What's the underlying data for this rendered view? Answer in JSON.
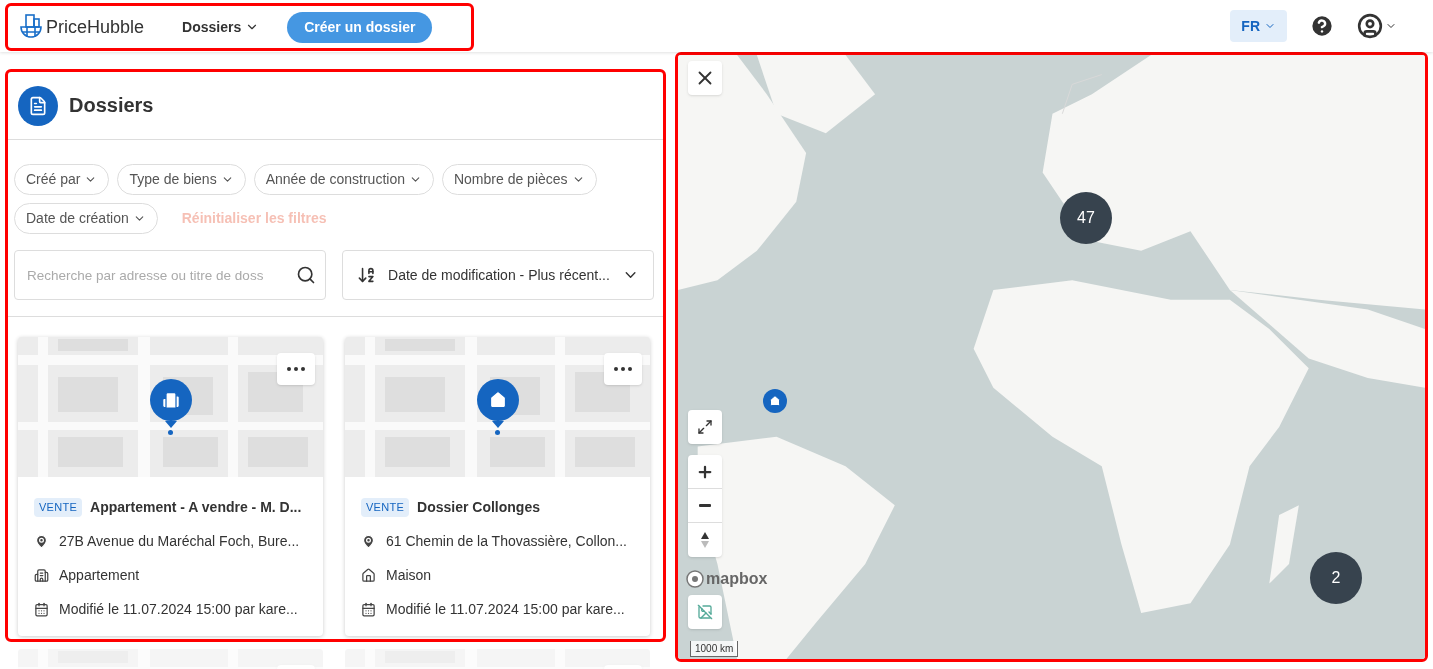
{
  "header": {
    "logo": "PriceHubble",
    "nav": [
      {
        "label": "Dossiers"
      }
    ],
    "create_button": "Créer un dossier",
    "language": "FR"
  },
  "panel": {
    "title": "Dossiers",
    "filters": [
      "Créé par",
      "Type de biens",
      "Année de construction",
      "Nombre de pièces",
      "Date de création"
    ],
    "reset_filters": "Réinitialiser les filtres",
    "search": {
      "placeholder": "Recherche par adresse ou titre de doss"
    },
    "sort": "Date de modification - Plus récent...",
    "cards": [
      {
        "kind": "apartment",
        "tag": "VENTE",
        "title": "Appartement - A vendre - M. D...",
        "address": "27B Avenue du Maréchal Foch, Bure...",
        "property_type": "Appartement",
        "modified": "Modifié le 11.07.2024 15:00 par kare..."
      },
      {
        "kind": "house",
        "tag": "VENTE",
        "title": "Dossier Collonges",
        "address": "61 Chemin de la Thovassière, Collon...",
        "property_type": "Maison",
        "modified": "Modifié le 11.07.2024 15:00 par kare..."
      }
    ]
  },
  "map": {
    "clusters": [
      {
        "count": "47"
      },
      {
        "count": "2"
      }
    ],
    "attribution": "mapbox",
    "scale": "1000 km"
  }
}
